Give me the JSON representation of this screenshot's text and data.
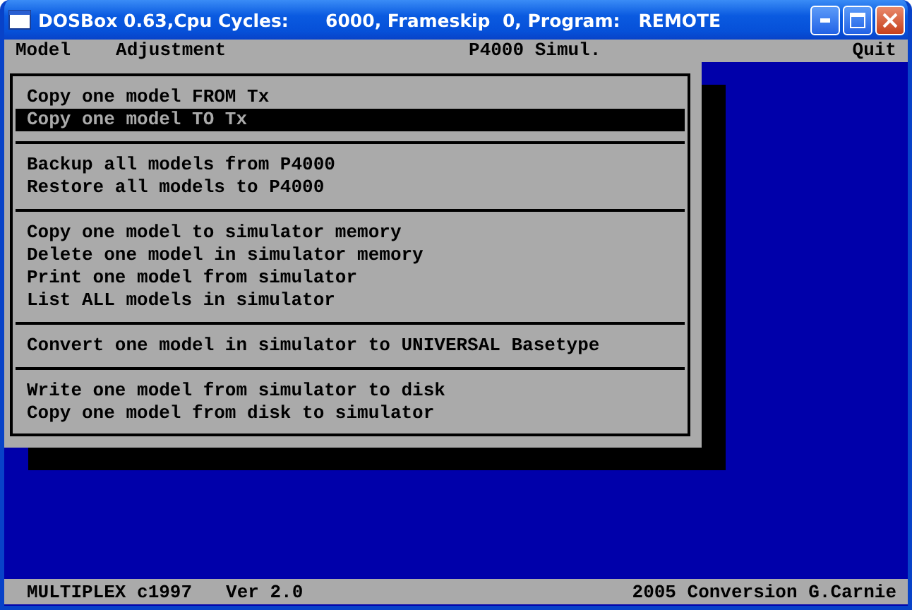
{
  "window": {
    "title": "DOSBox 0.63,Cpu Cycles:      6000, Frameskip  0, Program:   REMOTE"
  },
  "menu_bar": [
    {
      "label": "Model"
    },
    {
      "label": "Adjustment"
    },
    {
      "label": "P4000 Simul."
    },
    {
      "label": "Quit"
    }
  ],
  "menu_groups": [
    {
      "items": [
        {
          "label": "Copy one model FROM Tx",
          "selected": false
        },
        {
          "label": "Copy one model TO Tx",
          "selected": true
        }
      ]
    },
    {
      "items": [
        {
          "label": "Backup all models from P4000",
          "selected": false
        },
        {
          "label": "Restore all models to P4000",
          "selected": false
        }
      ]
    },
    {
      "items": [
        {
          "label": "Copy one model to simulator memory",
          "selected": false
        },
        {
          "label": "Delete one model in simulator memory",
          "selected": false
        },
        {
          "label": "Print one model from simulator",
          "selected": false
        },
        {
          "label": "List ALL models in simulator",
          "selected": false
        }
      ]
    },
    {
      "items": [
        {
          "label": "Convert one model in simulator to UNIVERSAL Basetype",
          "selected": false
        }
      ]
    },
    {
      "items": [
        {
          "label": "Write one model from simulator to disk",
          "selected": false
        },
        {
          "label": "Copy one model from disk to simulator",
          "selected": false
        }
      ]
    }
  ],
  "status_bar": {
    "left": [
      "MULTIPLEX c1997",
      "Ver 2.0"
    ],
    "right": "2005 Conversion G.Carnie"
  }
}
